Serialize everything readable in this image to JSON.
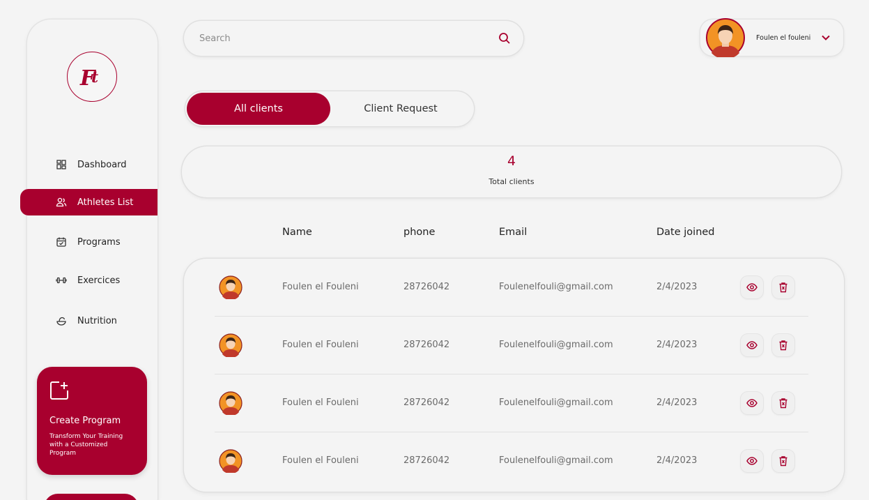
{
  "app": {
    "logo_text": "Ft",
    "accent": "#a8002e",
    "background": "#f4f4f4"
  },
  "sidebar": {
    "items": [
      {
        "label": "Dashboard",
        "icon": "dashboard-icon",
        "active": false
      },
      {
        "label": "Athletes List",
        "icon": "users-icon",
        "active": true
      },
      {
        "label": "Programs",
        "icon": "calendar-icon",
        "active": false
      },
      {
        "label": "Exercices",
        "icon": "dumbbell-icon",
        "active": false
      },
      {
        "label": "Nutrition",
        "icon": "nutrition-icon",
        "active": false
      }
    ],
    "create_card": {
      "icon": "add-square-icon",
      "title": "Create  Program",
      "description": "Transform Your Training with a Customized Program"
    }
  },
  "search": {
    "placeholder": "Search",
    "value": ""
  },
  "profile": {
    "name": "Foulen el fouleni",
    "icon": "chevron-down-icon"
  },
  "tabs": [
    {
      "label": "All clients",
      "active": true
    },
    {
      "label": "Client Request",
      "active": false
    }
  ],
  "stats": {
    "total_clients": "4",
    "total_label": "Total clients"
  },
  "table": {
    "columns": [
      "Name",
      "phone",
      "Email",
      "Date joined"
    ],
    "rows": [
      {
        "name": "Foulen el Fouleni",
        "phone": "28726042",
        "email": "Foulenelfouli@gmail.com",
        "date": "2/4/2023"
      },
      {
        "name": "Foulen el Fouleni",
        "phone": "28726042",
        "email": "Foulenelfouli@gmail.com",
        "date": "2/4/2023"
      },
      {
        "name": "Foulen el Fouleni",
        "phone": "28726042",
        "email": "Foulenelfouli@gmail.com",
        "date": "2/4/2023"
      },
      {
        "name": "Foulen el Fouleni",
        "phone": "28726042",
        "email": "Foulenelfouli@gmail.com",
        "date": "2/4/2023"
      }
    ]
  }
}
